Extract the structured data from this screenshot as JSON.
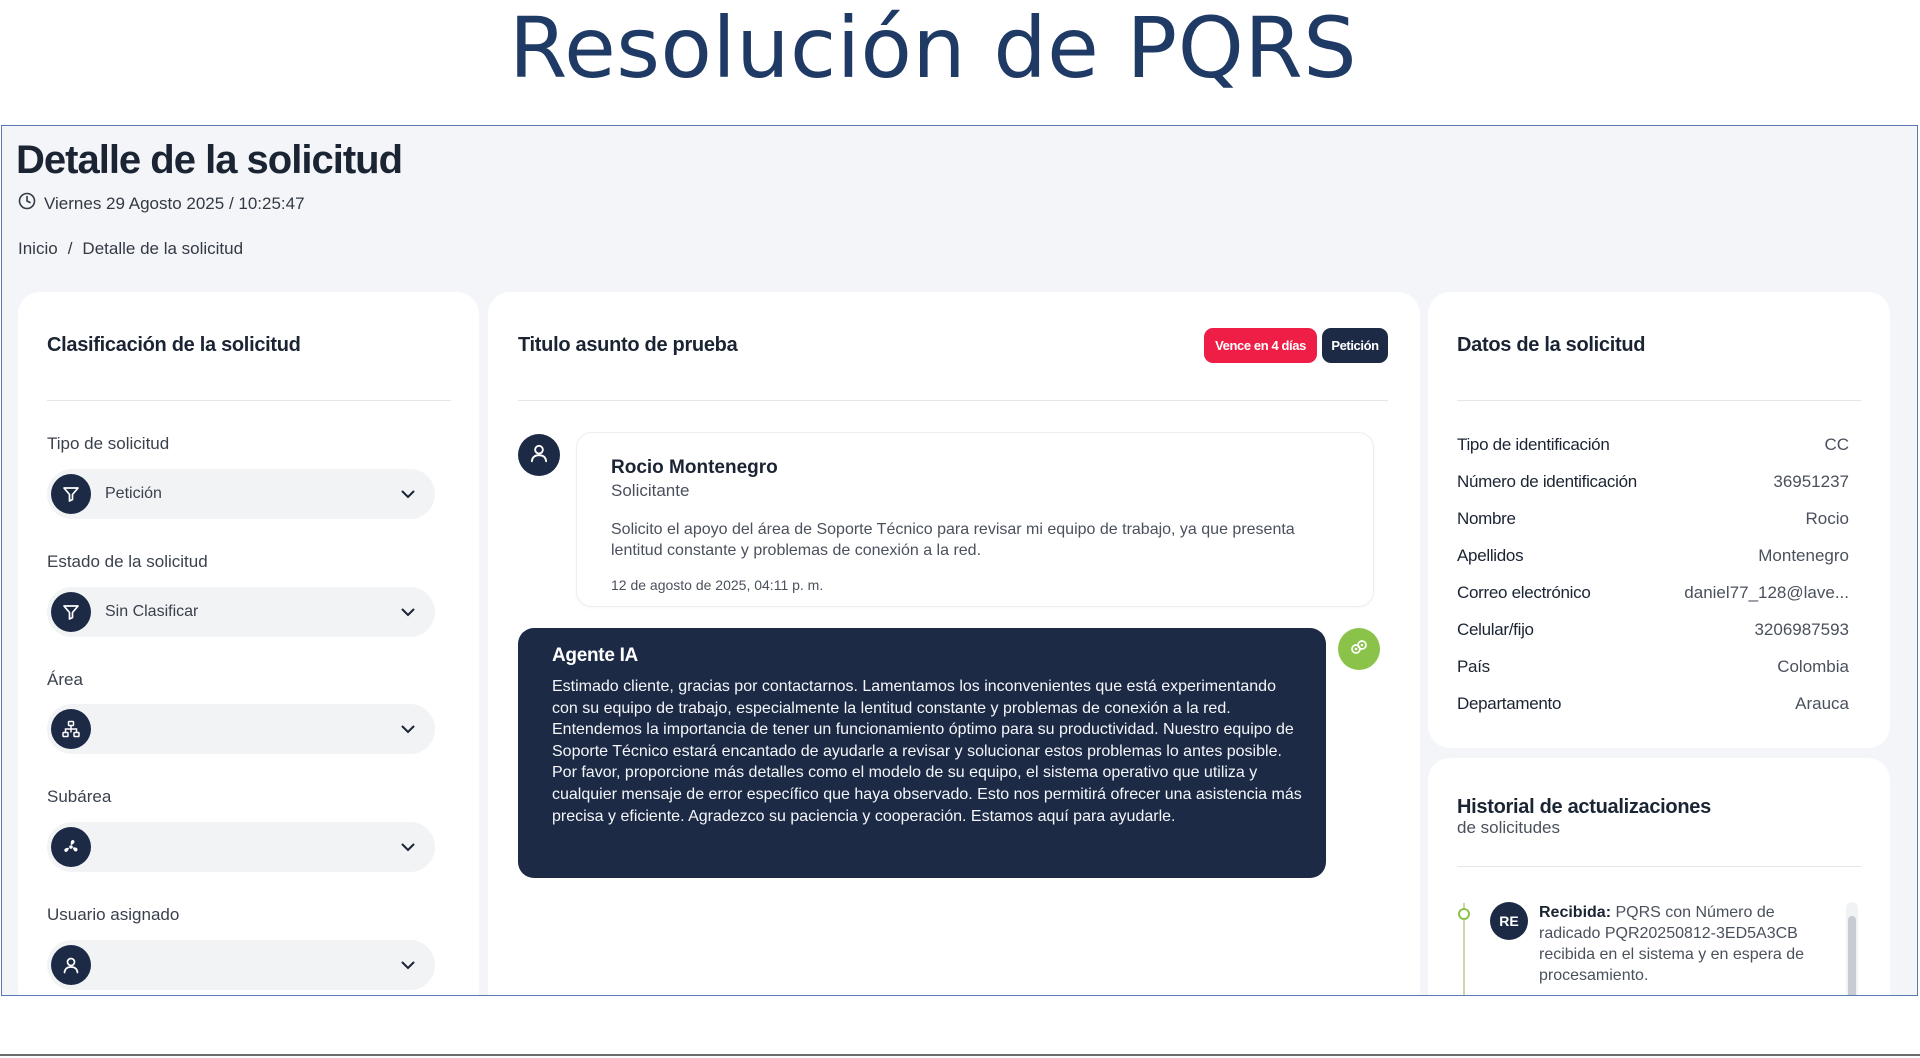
{
  "slide": {
    "title": "Resolución de PQRS"
  },
  "header": {
    "title": "Detalle de la solicitud",
    "datetime": "Viernes 29 Agosto 2025 / 10:25:47",
    "breadcrumb": {
      "home": "Inicio",
      "separator": "/",
      "current": "Detalle de la solicitud"
    }
  },
  "classification": {
    "title": "Clasificación de la solicitud",
    "fields": [
      {
        "label": "Tipo de solicitud",
        "value": "Petición",
        "icon": "filter-icon"
      },
      {
        "label": "Estado de la solicitud",
        "value": "Sin Clasificar",
        "icon": "filter-icon"
      },
      {
        "label": "Área",
        "value": "",
        "icon": "hierarchy-icon"
      },
      {
        "label": "Subárea",
        "value": "",
        "icon": "fan-icon"
      },
      {
        "label": "Usuario asignado",
        "value": "",
        "icon": "user-icon"
      }
    ]
  },
  "request": {
    "subject": "Titulo asunto de prueba",
    "badges": {
      "due": "Vence en 4 días",
      "type": "Petición"
    },
    "message": {
      "author": "Rocio Montenegro",
      "role": "Solicitante",
      "body": "Solicito el apoyo del área de Soporte Técnico para revisar mi equipo de trabajo, ya que presenta lentitud constante y problemas de conexión a la red.",
      "date": "12 de agosto de 2025, 04:11 p. m."
    },
    "agent": {
      "name": "Agente IA",
      "body": "Estimado cliente, gracias por contactarnos. Lamentamos los inconvenientes que está experimentando con su equipo de trabajo, especialmente la lentitud constante y problemas de conexión a la red. Entendemos la importancia de tener un funcionamiento óptimo para su productividad. Nuestro equipo de Soporte Técnico estará encantado de ayudarle a revisar y solucionar estos problemas lo antes posible. Por favor, proporcione más detalles como el modelo de su equipo, el sistema operativo que utiliza y cualquier mensaje de error específico que haya observado. Esto nos permitirá ofrecer una asistencia más precisa y eficiente. Agradezco su paciencia y cooperación. Estamos aquí para ayudarle."
    }
  },
  "details": {
    "title": "Datos de la solicitud",
    "rows": [
      {
        "key": "Tipo de identificación",
        "value": "CC"
      },
      {
        "key": "Número de identificación",
        "value": "36951237"
      },
      {
        "key": "Nombre",
        "value": "Rocio"
      },
      {
        "key": "Apellidos",
        "value": "Montenegro"
      },
      {
        "key": "Correo electrónico",
        "value": "daniel77_128@lave..."
      },
      {
        "key": "Celular/fijo",
        "value": "3206987593"
      },
      {
        "key": "País",
        "value": "Colombia"
      },
      {
        "key": "Departamento",
        "value": "Arauca"
      }
    ]
  },
  "history": {
    "title": "Historial de actualizaciones",
    "subtitle": "de solicitudes",
    "entries": [
      {
        "initials": "RE",
        "status": "Recibida:",
        "text": "PQRS con Número de radicado PQR20250812-3ED5A3CB recibida en el sistema y en espera de procesamiento."
      }
    ]
  },
  "colors": {
    "primary": "#1c2a45",
    "danger": "#ee1e47",
    "accent": "#8bc34a",
    "slide_title": "#1f3a64"
  }
}
